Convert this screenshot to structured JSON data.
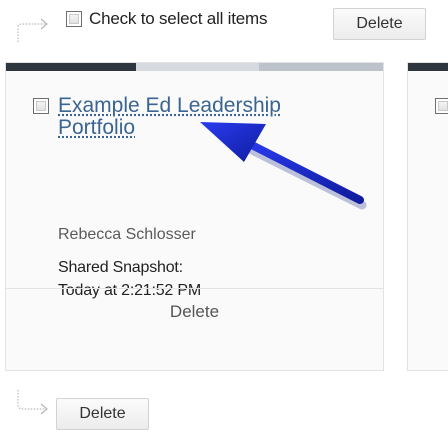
{
  "toolbar_top": {
    "select_all_label": "Check to select all items",
    "delete_label": "Delete"
  },
  "card": {
    "title": "Example Ed Leadership Portfolio",
    "author": "Rebecca Schlosser",
    "snapshot_line1": "Shared Snapshot:",
    "snapshot_line2": "Today at 2:21:52 PM",
    "delete_label": "Delete"
  },
  "toolbar_bottom": {
    "delete_label": "Delete"
  },
  "colors": {
    "link": "#3a6592",
    "card_bar_dark": "#2e3640",
    "annotation_arrow": "#1f2fd6"
  },
  "icons": [
    "select-all-arrow-icon",
    "bottom-arrow-icon",
    "annotation-arrow-icon"
  ]
}
